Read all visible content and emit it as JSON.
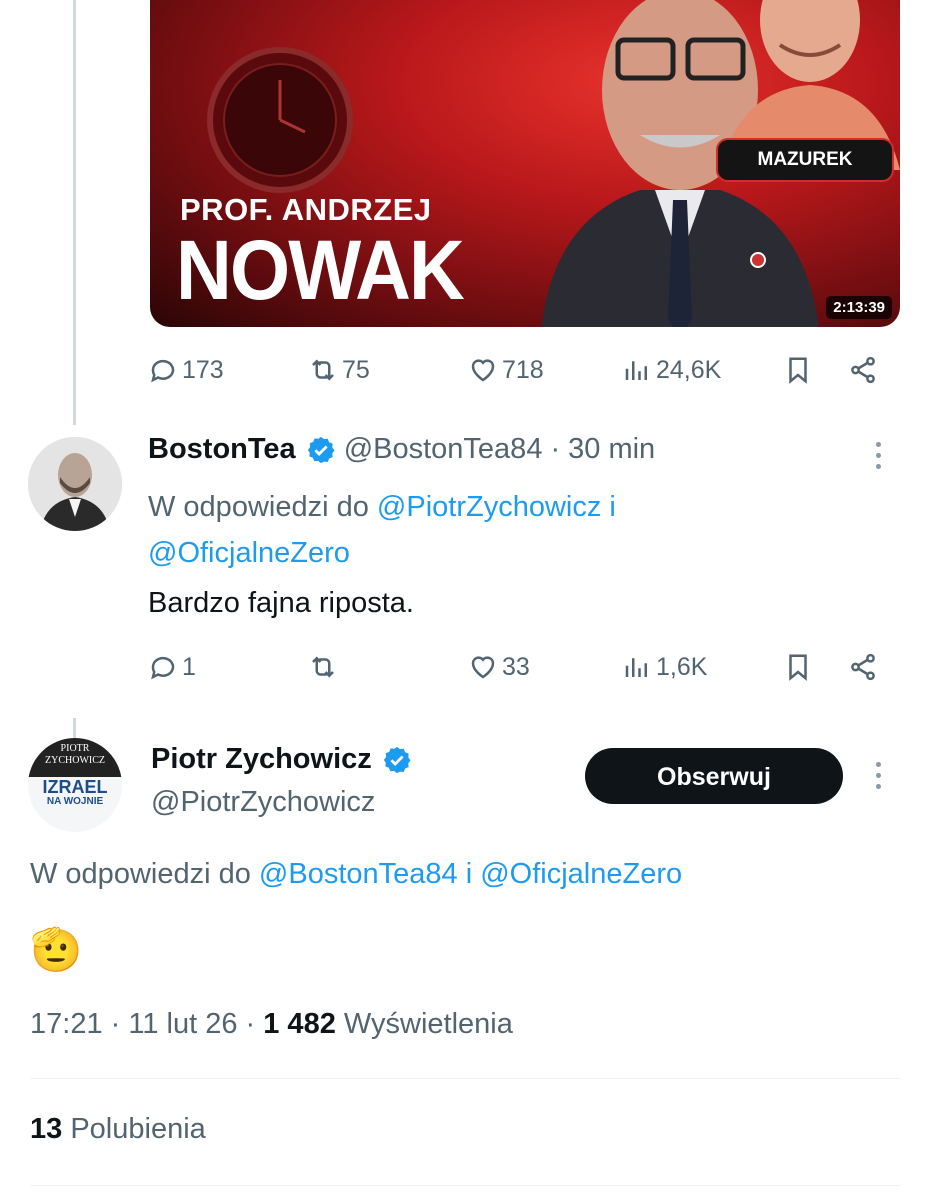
{
  "media_card": {
    "subtitle": "PROF. ANDRZEJ",
    "title": "NOWAK",
    "badge": "MAZUREK",
    "duration": "2:13:39"
  },
  "first_tweet_actions": {
    "replies": "173",
    "retweets": "75",
    "likes": "718",
    "views": "24,6K"
  },
  "reply_tweet": {
    "name": "BostonTea",
    "handle": "@BostonTea84",
    "separator": "·",
    "time": "30 min",
    "reply_prefix": "W odpowiedzi do",
    "reply_to_1": "@PiotrZychowicz",
    "reply_and": "i",
    "reply_to_2": "@OficjalneZero",
    "text": "Bardzo fajna riposta.",
    "actions": {
      "replies": "1",
      "retweets": "",
      "likes": "33",
      "views": "1,6K"
    }
  },
  "main_tweet": {
    "avatar_text": {
      "line1": "PIOTR",
      "line2": "ZYCHOWICZ",
      "line3": "IZRAEL",
      "line4": "NA WOJNIE"
    },
    "name": "Piotr Zychowicz",
    "handle": "@PiotrZychowicz",
    "follow_label": "Obserwuj",
    "reply_prefix": "W odpowiedzi do",
    "reply_to_1": "@BostonTea84",
    "reply_and": "i",
    "reply_to_2": "@OficjalneZero",
    "emoji": "🫡",
    "time": "17:21",
    "date": "11 lut 26",
    "views_count": "1 482",
    "views_label": "Wyświetlenia",
    "likes_count": "13",
    "likes_label": "Polubienia"
  },
  "colors": {
    "link": "#1d9bf0",
    "verified": "#1d9bf0",
    "muted": "#536471"
  }
}
